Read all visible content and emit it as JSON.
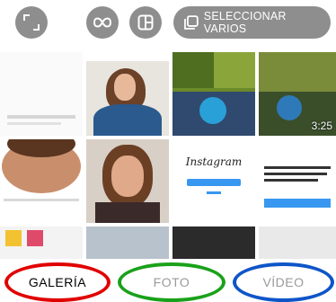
{
  "toolbar": {
    "expand_icon": "expand-corners-icon",
    "boomerang_icon": "infinity-icon",
    "layout_icon": "layout-icon",
    "select_multiple_label": "SELECCIONAR VARIOS",
    "select_multiple_icon": "multi-select-icon"
  },
  "gallery": {
    "video_duration": "3:25",
    "instagram_logo_text": "Instagram"
  },
  "tabs": [
    {
      "label": "GALERÍA",
      "ring_color": "#e10000"
    },
    {
      "label": "FOTO",
      "ring_color": "#1aa11a"
    },
    {
      "label": "VÍDEO",
      "ring_color": "#0f55c8"
    }
  ],
  "colors": {
    "button_bg": "#8e8e8e",
    "selected_text": "#000000",
    "unselected_text": "#9a9a9a"
  }
}
